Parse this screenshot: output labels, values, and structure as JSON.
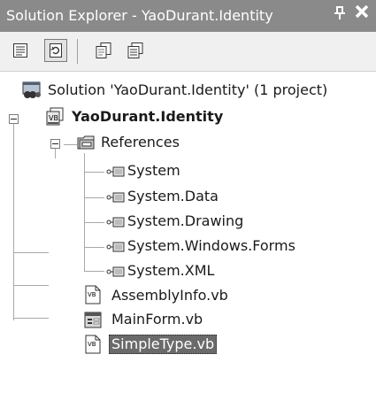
{
  "window": {
    "title": "Solution Explorer - YaoDurant.Identity",
    "pin_glyph": "1",
    "close_glyph": "✕"
  },
  "toolbar": {
    "buttons": [
      {
        "name": "properties",
        "icon": "properties-icon"
      },
      {
        "name": "refresh",
        "icon": "refresh-icon",
        "pressed": true
      },
      {
        "name": "show-all-files",
        "icon": "show-all-files-icon"
      },
      {
        "name": "view-code",
        "icon": "view-code-icon"
      }
    ]
  },
  "tree": {
    "solution": "Solution 'YaoDurant.Identity' (1 project)",
    "project": "YaoDurant.Identity",
    "references": "References",
    "reference_items": [
      "System",
      "System.Data",
      "System.Drawing",
      "System.Windows.Forms",
      "System.XML"
    ],
    "files": [
      "AssemblyInfo.vb",
      "MainForm.vb",
      "SimpleType.vb"
    ],
    "selected": "SimpleType.vb"
  }
}
